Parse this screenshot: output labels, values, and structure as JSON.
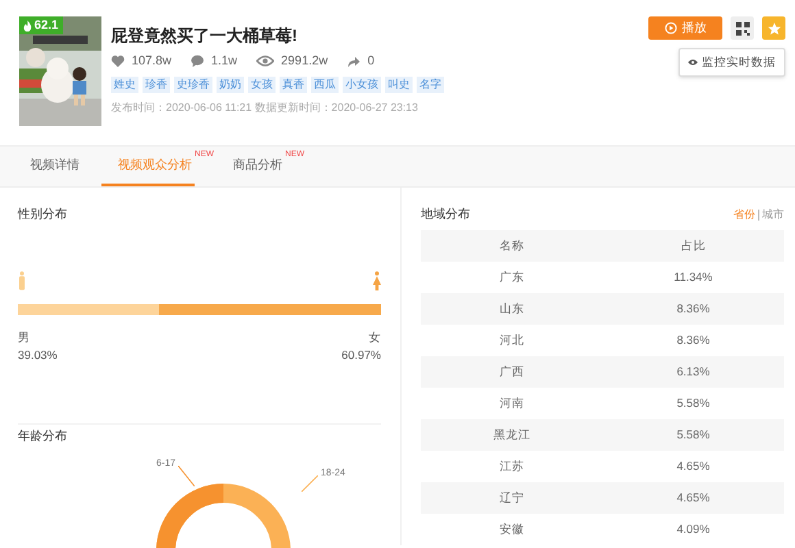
{
  "video": {
    "score": "62.1",
    "title": "屁登竟然买了一大桶草莓!",
    "stats": [
      {
        "kind": "like",
        "value": "107.8w"
      },
      {
        "kind": "comment",
        "value": "1.1w"
      },
      {
        "kind": "view",
        "value": "2991.2w"
      },
      {
        "kind": "share",
        "value": "0"
      }
    ],
    "tags": [
      "姓史",
      "珍香",
      "史珍香",
      "奶奶",
      "女孩",
      "真香",
      "西瓜",
      "小女孩",
      "叫史",
      "名字"
    ],
    "dates": "发布时间：2020-06-06 11:21 数据更新时间：2020-06-27 23:13"
  },
  "actions": {
    "play": "播放",
    "monitor": "监控实时数据"
  },
  "tabs": [
    {
      "label": "视频详情",
      "selected": false
    },
    {
      "label": "视频观众分析",
      "selected": true,
      "badge": "NEW"
    },
    {
      "label": "商品分析",
      "selected": false,
      "badge": "NEW"
    }
  ],
  "gender": {
    "title": "性别分布",
    "level": 0.3903,
    "male": {
      "label": "男",
      "value": "39.03%"
    },
    "female": {
      "label": "女",
      "value": "60.97%"
    }
  },
  "age": {
    "title": "年龄分布",
    "labels": [
      "6-17",
      "18-24"
    ]
  },
  "region": {
    "title": "地域分布",
    "toggle": [
      {
        "label": "省份",
        "selected": true
      },
      {
        "label": "城市",
        "selected": false
      }
    ],
    "columns": [
      "名称",
      "占比"
    ],
    "rows": [
      [
        "广东",
        "11.34%"
      ],
      [
        "山东",
        "8.36%"
      ],
      [
        "河北",
        "8.36%"
      ],
      [
        "广西",
        "6.13%"
      ],
      [
        "河南",
        "5.58%"
      ],
      [
        "黑龙江",
        "5.58%"
      ],
      [
        "江苏",
        "4.65%"
      ],
      [
        "辽宁",
        "4.65%"
      ],
      [
        "安徽",
        "4.09%"
      ]
    ]
  }
}
